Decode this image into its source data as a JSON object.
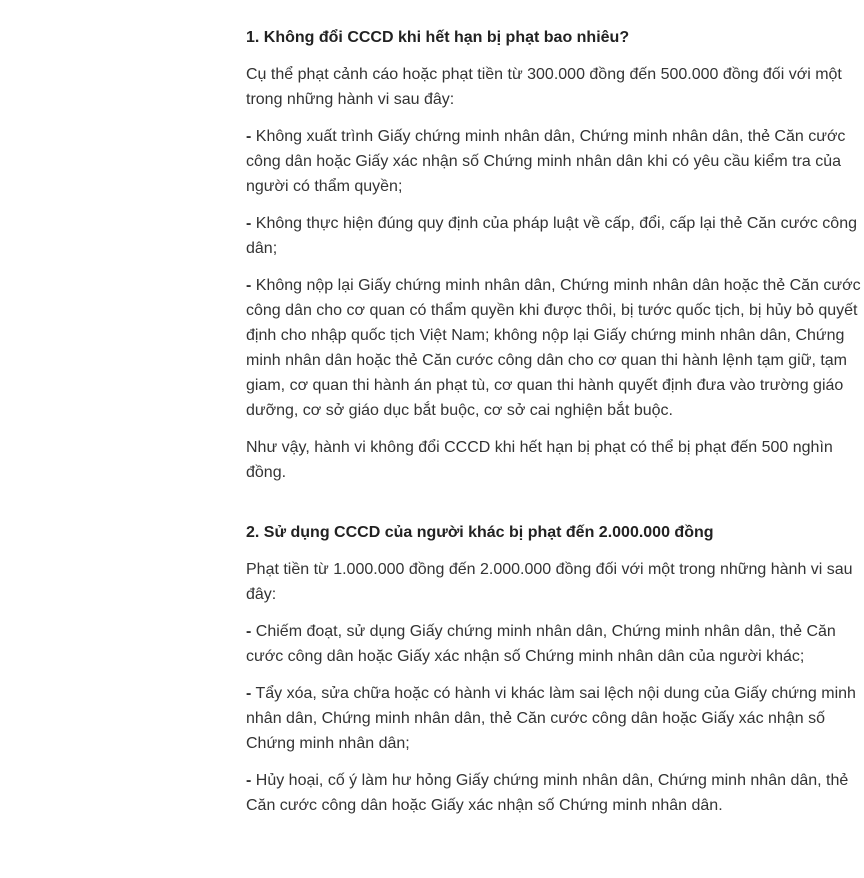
{
  "sections": [
    {
      "heading": "1. Không đổi CCCD khi hết hạn bị phạt bao nhiêu?",
      "intro": "Cụ thể phạt cảnh cáo hoặc phạt tiền từ 300.000 đồng đến 500.000 đồng đối với một trong những hành vi sau đây:",
      "items": [
        "Không xuất trình Giấy chứng minh nhân dân, Chứng minh nhân dân, thẻ Căn cước công dân hoặc Giấy xác nhận số Chứng minh nhân dân khi có yêu cầu kiểm tra của người có thẩm quyền;",
        "Không thực hiện đúng quy định của pháp luật về cấp, đổi, cấp lại thẻ Căn cước công dân;",
        "Không nộp lại Giấy chứng minh nhân dân, Chứng minh nhân dân hoặc thẻ Căn cước công dân cho cơ quan có thẩm quyền khi được thôi, bị tước quốc tịch, bị hủy bỏ quyết định cho nhập quốc tịch Việt Nam; không nộp lại Giấy chứng minh nhân dân, Chứng minh nhân dân hoặc thẻ Căn cước công dân cho cơ quan thi hành lệnh tạm giữ, tạm giam, cơ quan thi hành án phạt tù, cơ quan thi hành quyết định đưa vào trường giáo dưỡng, cơ sở giáo dục bắt buộc, cơ sở cai nghiện bắt buộc."
      ],
      "conclusion": "Như vậy, hành vi không đổi CCCD khi hết hạn bị phạt có thể bị phạt đến 500 nghìn đồng."
    },
    {
      "heading": "2. Sử dụng CCCD của người khác bị phạt đến 2.000.000 đồng",
      "intro": "Phạt tiền từ 1.000.000 đồng đến 2.000.000 đồng đối với một trong những hành vi sau đây:",
      "items": [
        "Chiếm đoạt, sử dụng Giấy chứng minh nhân dân, Chứng minh nhân dân, thẻ Căn cước công dân hoặc Giấy xác nhận số Chứng minh nhân dân của người khác;",
        "Tẩy xóa, sửa chữa hoặc có hành vi khác làm sai lệch nội dung của Giấy chứng minh nhân dân, Chứng minh nhân dân, thẻ Căn cước công dân hoặc Giấy xác nhận số Chứng minh nhân dân;",
        "Hủy hoại, cố ý làm hư hỏng Giấy chứng minh nhân dân, Chứng minh nhân dân, thẻ Căn cước công dân hoặc Giấy xác nhận số Chứng minh nhân dân."
      ]
    }
  ],
  "bullet": "-"
}
